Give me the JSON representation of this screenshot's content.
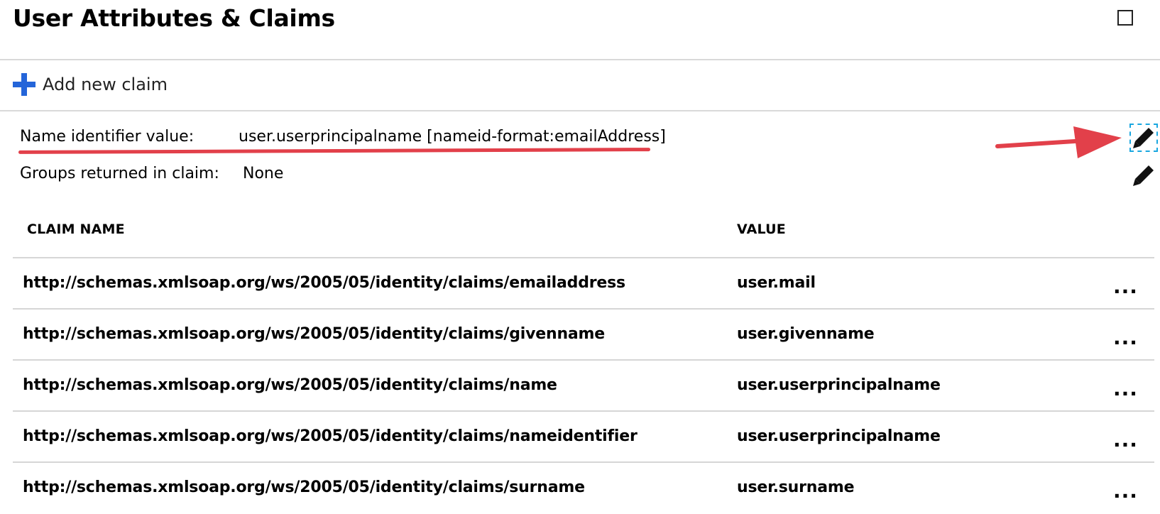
{
  "header": {
    "title": "User Attributes & Claims",
    "maximize_icon": "maximize-square-icon"
  },
  "toolbar": {
    "add_label": "Add new claim",
    "add_icon": "plus-icon",
    "accent_color": "#2465d9"
  },
  "info": {
    "name_identifier_label": "Name identifier value:",
    "name_identifier_value": "user.userprincipalname [nameid-format:emailAddress]",
    "groups_label": "Groups returned in claim:",
    "groups_value": "None",
    "edit_icon": "pencil-icon"
  },
  "annotation": {
    "color": "#e2404a",
    "arrow_icon": "red-arrow-icon"
  },
  "table": {
    "headers": [
      "CLAIM NAME",
      "VALUE"
    ],
    "rows": [
      {
        "name": "http://schemas.xmlsoap.org/ws/2005/05/identity/claims/emailaddress",
        "value": "user.mail",
        "more": "..."
      },
      {
        "name": "http://schemas.xmlsoap.org/ws/2005/05/identity/claims/givenname",
        "value": "user.givenname",
        "more": "..."
      },
      {
        "name": "http://schemas.xmlsoap.org/ws/2005/05/identity/claims/name",
        "value": "user.userprincipalname",
        "more": "..."
      },
      {
        "name": "http://schemas.xmlsoap.org/ws/2005/05/identity/claims/nameidentifier",
        "value": "user.userprincipalname",
        "more": "..."
      },
      {
        "name": "http://schemas.xmlsoap.org/ws/2005/05/identity/claims/surname",
        "value": "user.surname",
        "more": "..."
      }
    ]
  }
}
